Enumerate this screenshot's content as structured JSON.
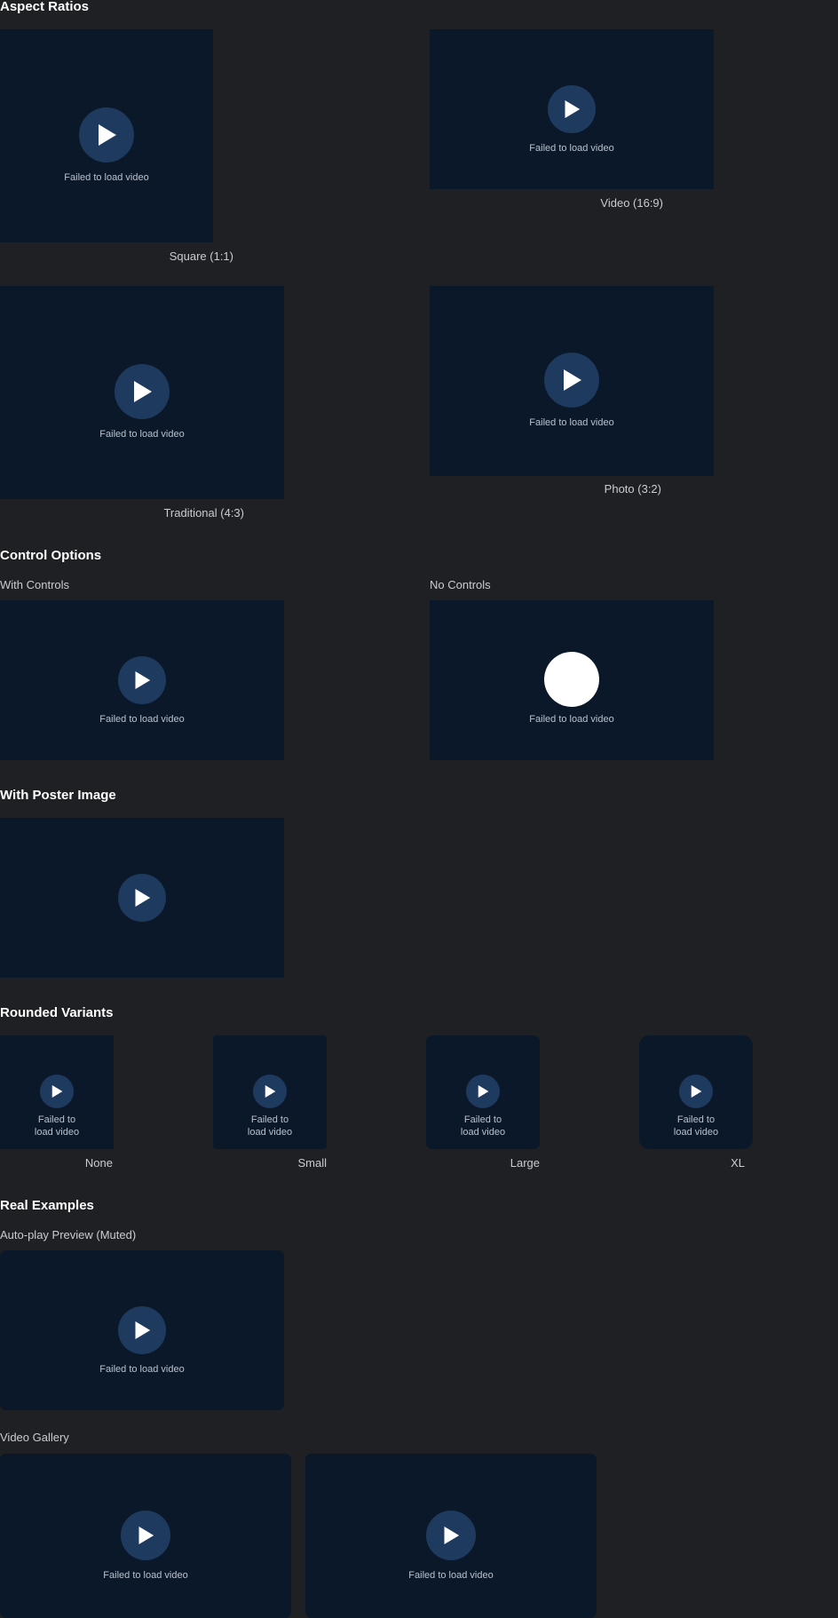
{
  "sections": {
    "aspect_ratios": "Aspect Ratios",
    "control_options": "Control Options",
    "poster": "With Poster Image",
    "rounded": "Rounded Variants",
    "real": "Real Examples"
  },
  "error_text": "Failed to load video",
  "error_text_short_1": "Failed to",
  "error_text_short_2": "load video",
  "aspect": {
    "square": "Square (1:1)",
    "video": "Video (16:9)",
    "traditional": "Traditional (4:3)",
    "photo": "Photo (3:2)"
  },
  "controls": {
    "with": "With Controls",
    "none": "No Controls"
  },
  "rounded": {
    "none": "None",
    "small": "Small",
    "large": "Large",
    "xl": "XL"
  },
  "real": {
    "autoplay": "Auto-play Preview (Muted)",
    "gallery": "Video Gallery"
  },
  "colors": {
    "background": "#1f2023",
    "video_bg": "#0b1829",
    "play_button": "#1f3a5f"
  }
}
